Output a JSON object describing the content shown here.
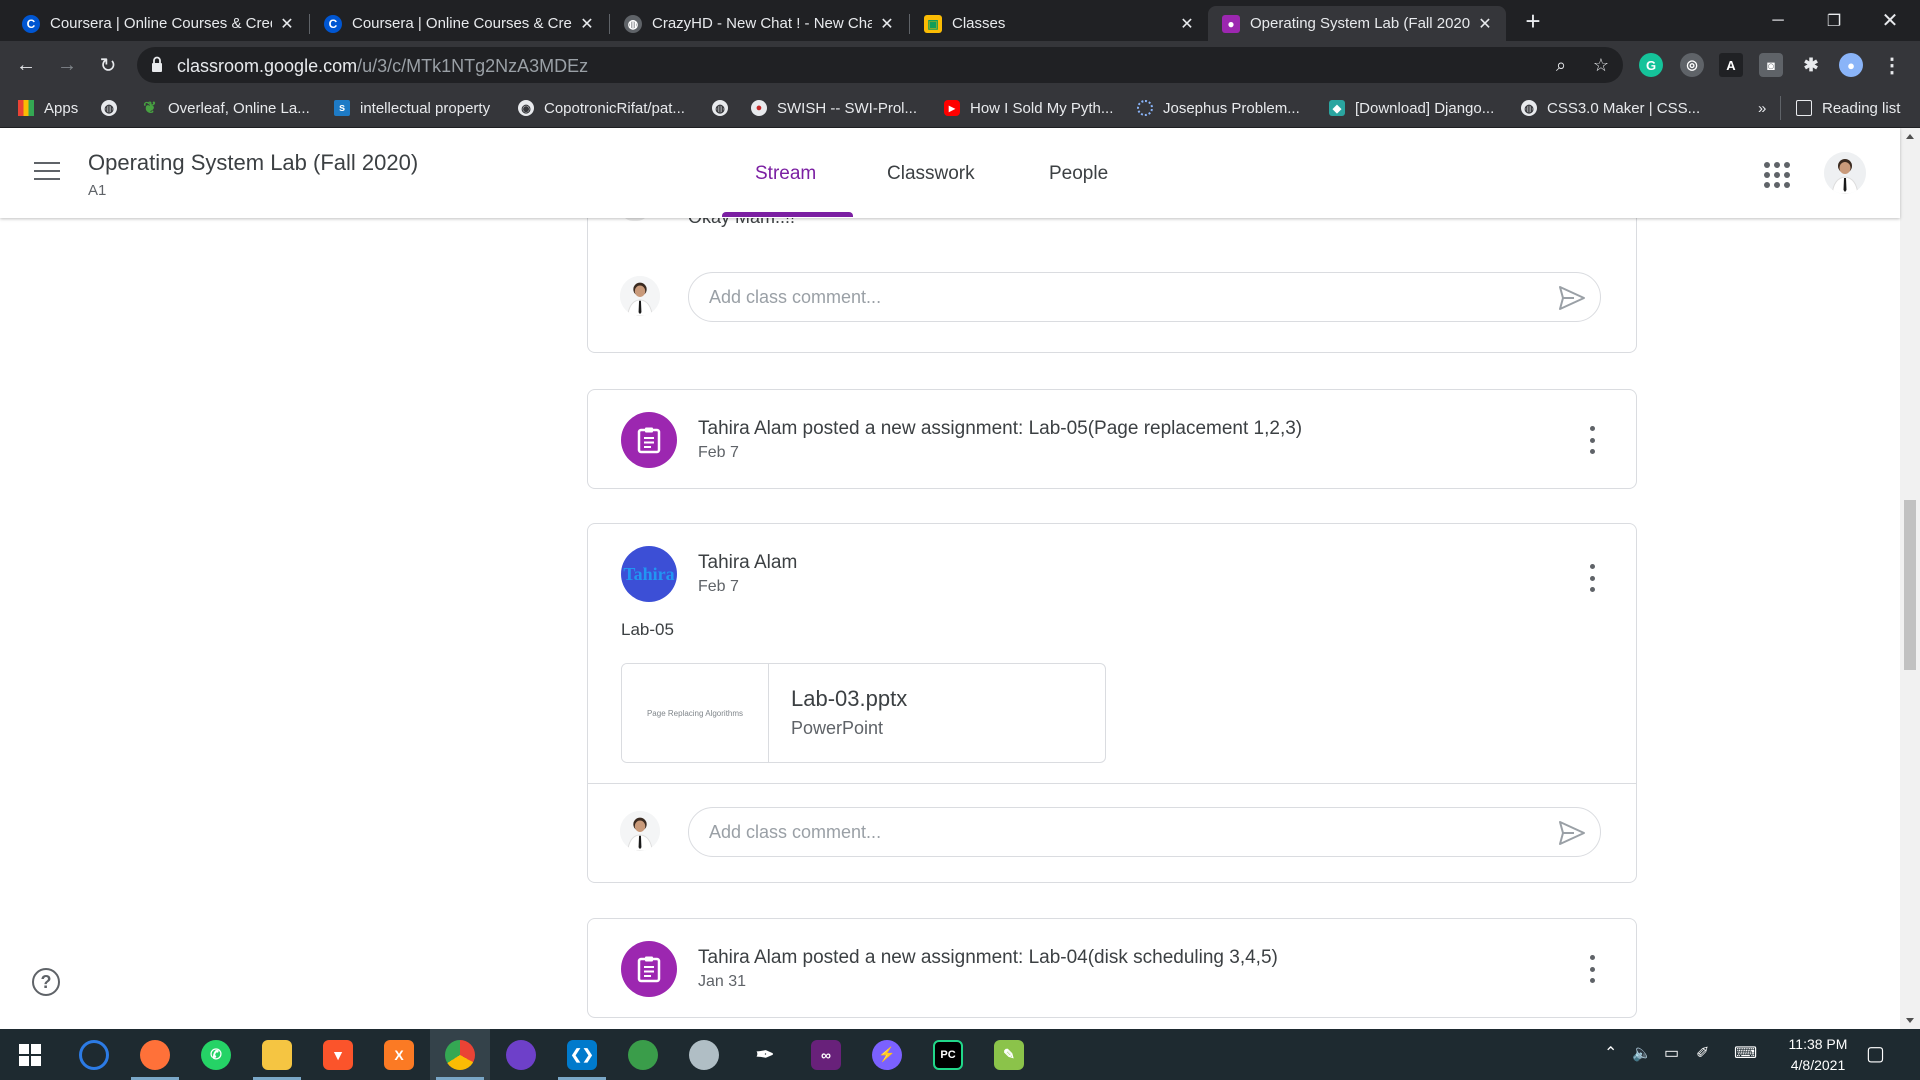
{
  "browser": {
    "tabs": [
      {
        "title": "Coursera | Online Courses & Cred",
        "icon": "coursera-icon",
        "active": false
      },
      {
        "title": "Coursera | Online Courses & Cred",
        "icon": "coursera-icon",
        "active": false
      },
      {
        "title": "CrazyHD - New Chat ! - New Cha",
        "icon": "globe-icon",
        "active": false
      },
      {
        "title": "Classes",
        "icon": "classroom-icon",
        "active": false
      },
      {
        "title": "Operating System Lab (Fall 2020)",
        "icon": "classroom-icon",
        "active": true
      }
    ],
    "new_tab": "+",
    "url_host": "classroom.google.com",
    "url_path": "/u/3/c/MTk1NTg2NzA3MDEz",
    "bookmarks": [
      {
        "label": "Apps",
        "icon": "apps-grid-icon"
      },
      {
        "label": "",
        "icon": "globe-icon"
      },
      {
        "label": "Overleaf, Online La...",
        "icon": "overleaf-icon"
      },
      {
        "label": "intellectual property",
        "icon": "scribd-icon"
      },
      {
        "label": "CopotronicRifat/pat...",
        "icon": "github-icon"
      },
      {
        "label": "",
        "icon": "globe-icon"
      },
      {
        "label": "SWISH -- SWI-Prol...",
        "icon": "swish-icon"
      },
      {
        "label": "How I Sold My Pyth...",
        "icon": "youtube-icon"
      },
      {
        "label": "Josephus Problem...",
        "icon": "loading-icon"
      },
      {
        "label": "[Download] Django...",
        "icon": "download-site-icon"
      },
      {
        "label": "CSS3.0 Maker | CSS...",
        "icon": "globe-icon"
      }
    ],
    "bookmarks_overflow": "»",
    "reading_list": "Reading list"
  },
  "header": {
    "class_title": "Operating System Lab (Fall 2020)",
    "section": "A1",
    "tabs": [
      "Stream",
      "Classwork",
      "People"
    ],
    "active_tab": "Stream",
    "accent_color": "#7b1fa2"
  },
  "stream": {
    "partial_comment": "Okay Mam..!!",
    "comment_placeholder": "Add class comment...",
    "posts": [
      {
        "type": "assignment",
        "title": "Tahira Alam posted a new assignment: Lab-05(Page replacement 1,2,3)",
        "date": "Feb 7"
      },
      {
        "type": "announcement",
        "author": "Tahira Alam",
        "avatar_text": "Tahira",
        "date": "Feb 7",
        "body": "Lab-05",
        "attachment": {
          "name": "Lab-03.pptx",
          "kind": "PowerPoint",
          "thumb_text": "Page Replacing Algorithms"
        }
      },
      {
        "type": "assignment",
        "title": "Tahira Alam posted a new assignment: Lab-04(disk scheduling 3,4,5)",
        "date": "Jan 31"
      }
    ],
    "assignment_color": "#9c27b0"
  },
  "help_label": "?",
  "taskbar": {
    "apps": [
      "windows-start-icon",
      "eclipse-icon",
      "firefox-icon",
      "whatsapp-icon",
      "file-explorer-icon",
      "brave-icon",
      "xampp-icon",
      "chrome-icon",
      "github-desktop-icon",
      "vscode-icon",
      "earth-icon",
      "compass-icon",
      "inkscape-icon",
      "visual-studio-icon",
      "messenger-icon",
      "pycharm-icon",
      "notepad-icon"
    ],
    "time": "11:38 PM",
    "date": "4/8/2021"
  }
}
